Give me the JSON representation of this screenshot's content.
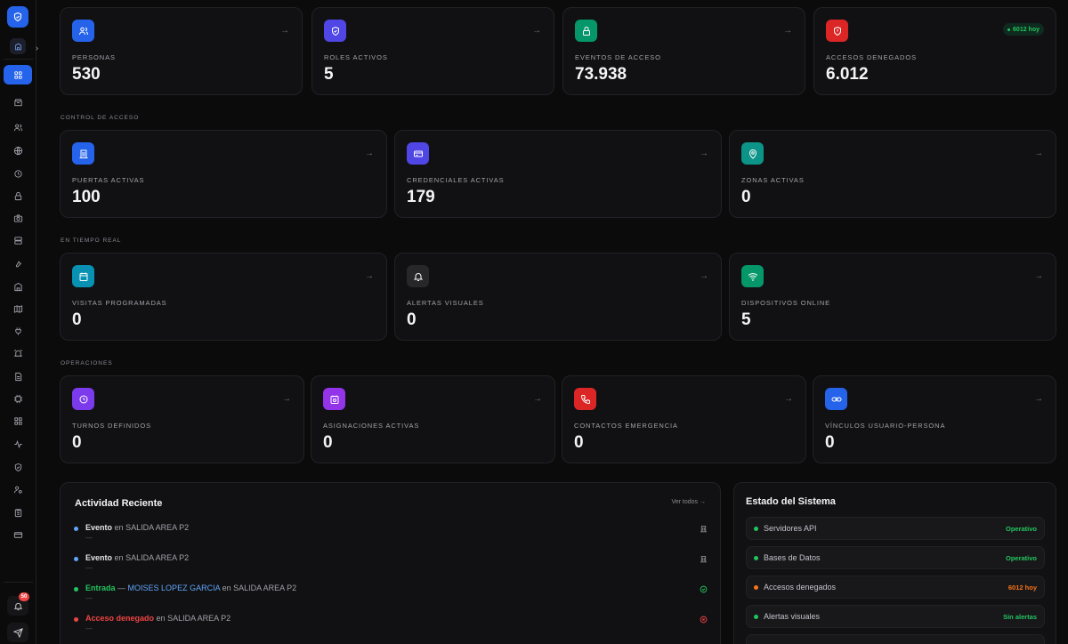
{
  "colors": {
    "accent": "#2563eb",
    "ok": "#22c55e",
    "warn": "#f97316",
    "danger": "#ef4444",
    "teal": "#22c55e"
  },
  "sidebar": {
    "notification_count": "50",
    "items": [
      "dashboard",
      "inbox",
      "users",
      "globe",
      "clock",
      "lock",
      "camera",
      "server",
      "wrench",
      "building",
      "map",
      "plug",
      "alarm",
      "document",
      "chip",
      "grid",
      "activity",
      "shield",
      "user-cog",
      "clipboard",
      "card"
    ]
  },
  "summary": [
    {
      "label": "PERSONAS",
      "value": "530",
      "icon": "users-icon",
      "color": "#2563eb"
    },
    {
      "label": "ROLES ACTIVOS",
      "value": "5",
      "icon": "shield-check-icon",
      "color": "#4f46e5"
    },
    {
      "label": "EVENTOS DE ACCESO",
      "value": "73.938",
      "icon": "lock-icon",
      "color": "#059669"
    },
    {
      "label": "ACCESOS DENEGADOS",
      "value": "6.012",
      "icon": "shield-alert-icon",
      "color": "#dc2626",
      "today": "6012 hoy"
    }
  ],
  "sections": {
    "control": "CONTROL DE ACCESO",
    "realtime": "EN TIEMPO REAL",
    "ops": "OPERACIONES"
  },
  "control": [
    {
      "label": "PUERTAS ACTIVAS",
      "value": "100",
      "icon": "door-icon",
      "color": "#2563eb"
    },
    {
      "label": "CREDENCIALES ACTIVAS",
      "value": "179",
      "icon": "credit-card-icon",
      "color": "#4f46e5"
    },
    {
      "label": "ZONAS ACTIVAS",
      "value": "0",
      "icon": "map-pin-icon",
      "color": "#0d9488"
    }
  ],
  "realtime": [
    {
      "label": "VISITAS PROGRAMADAS",
      "value": "0",
      "icon": "calendar-icon",
      "color": "#0891b2"
    },
    {
      "label": "ALERTAS VISUALES",
      "value": "0",
      "icon": "bell-icon",
      "color": "#27272a"
    },
    {
      "label": "DISPOSITIVOS ONLINE",
      "value": "5",
      "icon": "wifi-icon",
      "color": "#059669"
    }
  ],
  "ops": [
    {
      "label": "TURNOS DEFINIDOS",
      "value": "0",
      "icon": "clock-icon",
      "color": "#7c3aed"
    },
    {
      "label": "ASIGNACIONES ACTIVAS",
      "value": "0",
      "icon": "calendar-clock-icon",
      "color": "#9333ea"
    },
    {
      "label": "CONTACTOS EMERGENCIA",
      "value": "0",
      "icon": "phone-icon",
      "color": "#dc2626"
    },
    {
      "label": "VÍNCULOS USUARIO-PERSONA",
      "value": "0",
      "icon": "link-icon",
      "color": "#2563eb"
    }
  ],
  "activity": {
    "title": "Actividad Reciente",
    "see_all": "Ver todos →",
    "items": [
      {
        "kind": "Evento",
        "connector": "en",
        "place": "SALIDA AREA P2",
        "sub": "—"
      },
      {
        "kind": "Evento",
        "connector": "en",
        "place": "SALIDA AREA P2",
        "sub": "—"
      },
      {
        "kind": "Entrada",
        "dash": "—",
        "person": "MOISES LOPEZ GARCIA",
        "connector": "en",
        "place": "SALIDA AREA P2",
        "sub": "—"
      },
      {
        "kind": "Acceso denegado",
        "connector": "en",
        "place": "SALIDA AREA P2",
        "sub": "—"
      }
    ]
  },
  "system": {
    "title": "Estado del Sistema",
    "items": [
      {
        "name": "Servidores API",
        "status": "Operativo",
        "color": "#22c55e"
      },
      {
        "name": "Bases de Datos",
        "status": "Operativo",
        "color": "#22c55e"
      },
      {
        "name": "Accesos denegados",
        "status": "6012 hoy",
        "color": "#f97316"
      },
      {
        "name": "Alertas visuales",
        "status": "Sin alertas",
        "color": "#22c55e"
      }
    ]
  }
}
